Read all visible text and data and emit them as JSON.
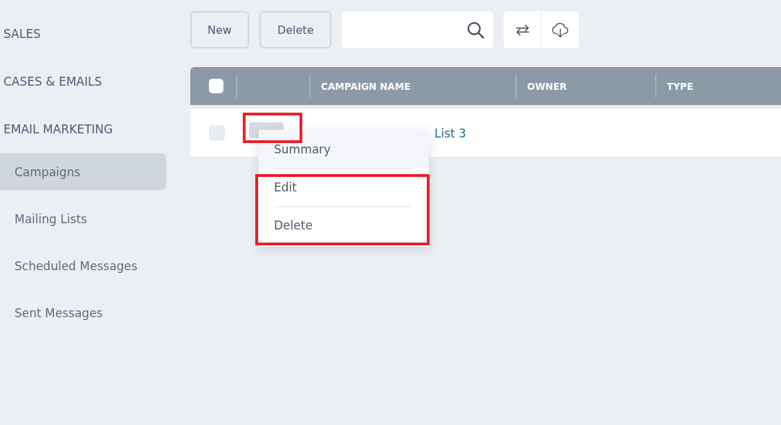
{
  "sidebar": {
    "sections": [
      {
        "label": "SALES"
      },
      {
        "label": "CASES & EMAILS"
      },
      {
        "label": "EMAIL MARKETING",
        "items": [
          {
            "label": "Campaigns",
            "selected": true
          },
          {
            "label": "Mailing Lists",
            "selected": false
          },
          {
            "label": "Scheduled Messages",
            "selected": false
          },
          {
            "label": "Sent Messages",
            "selected": false
          }
        ]
      }
    ]
  },
  "toolbar": {
    "buttons": [
      "New",
      "Delete"
    ]
  },
  "table": {
    "header_checkbox": {
      "checked": false
    },
    "columns": [
      "CAMPAIGN NAME",
      "OWNER",
      "TYPE"
    ],
    "rows": [
      {
        "checked": false,
        "campaign_name": "List 3",
        "actions_button": {
          "annotated": true
        }
      }
    ]
  },
  "row_menu": {
    "items": [
      {
        "label": "Summary",
        "hovered": true,
        "annotated": false
      },
      {
        "label": "Edit",
        "hovered": false,
        "annotated": true
      },
      {
        "label": "Delete",
        "hovered": false,
        "annotated": true
      }
    ]
  }
}
